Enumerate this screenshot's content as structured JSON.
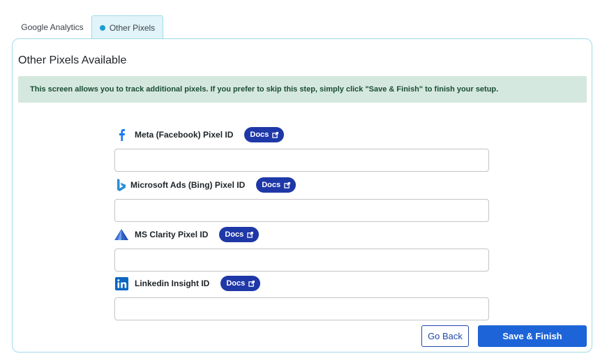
{
  "tabs": [
    {
      "label": "Google Analytics",
      "active": false
    },
    {
      "label": "Other Pixels",
      "active": true
    }
  ],
  "panel": {
    "title": "Other Pixels Available",
    "notice": "This screen allows you to track additional pixels. If you prefer to skip this step, simply click \"Save & Finish\" to finish your setup."
  },
  "fields": [
    {
      "label": "Meta (Facebook) Pixel ID",
      "icon": "facebook-icon",
      "docs_label": "Docs",
      "value": "",
      "placeholder": ""
    },
    {
      "label": "Microsoft Ads (Bing) Pixel ID",
      "icon": "bing-icon",
      "docs_label": "Docs",
      "value": "",
      "placeholder": ""
    },
    {
      "label": "MS Clarity Pixel ID",
      "icon": "clarity-icon",
      "docs_label": "Docs",
      "value": "",
      "placeholder": ""
    },
    {
      "label": "Linkedin Insight ID",
      "icon": "linkedin-icon",
      "docs_label": "Docs",
      "value": "",
      "placeholder": ""
    }
  ],
  "actions": {
    "back_label": "Go Back",
    "save_label": "Save & Finish"
  },
  "colors": {
    "accent": "#1d64d8",
    "docs_badge": "#1f38a8",
    "notice_bg": "#d5e8df",
    "tab_active_bg": "#e1f4f9"
  }
}
